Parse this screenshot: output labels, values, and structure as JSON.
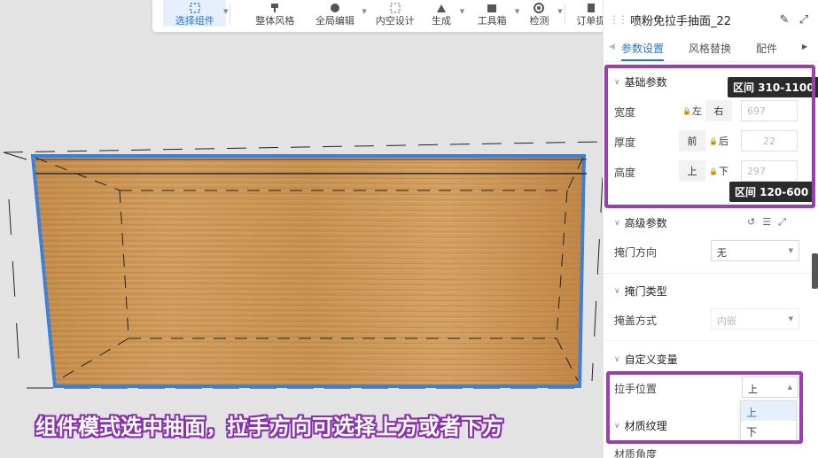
{
  "toolbar": {
    "items": [
      {
        "label": "选择组件",
        "icon": "select-component-icon"
      },
      {
        "label": "整体风格",
        "icon": "style-icon"
      },
      {
        "label": "全局编辑",
        "icon": "global-edit-icon"
      },
      {
        "label": "内空设计",
        "icon": "inner-space-icon"
      },
      {
        "label": "生成",
        "icon": "generate-icon"
      },
      {
        "label": "工具箱",
        "icon": "toolbox-icon"
      },
      {
        "label": "检测",
        "icon": "detect-icon"
      },
      {
        "label": "订单提",
        "icon": "order-icon"
      }
    ]
  },
  "panel": {
    "title": "喷粉免拉手抽面_22",
    "tabs": [
      "参数设置",
      "风格替换",
      "配件"
    ],
    "basic": {
      "title": "基础参数",
      "width_label": "宽度",
      "width_seg": [
        "左",
        "右"
      ],
      "width_value": "697",
      "thickness_label": "厚度",
      "thickness_seg": [
        "前",
        "后"
      ],
      "thickness_value": "22",
      "height_label": "高度",
      "height_seg": [
        "上",
        "下"
      ],
      "height_value": "297",
      "range_top": "区间 310-1100",
      "range_bottom": "区间 120-600"
    },
    "advanced": {
      "title": "高级参数",
      "door_dir_label": "掩门方向",
      "door_dir_value": "无"
    },
    "door_type": {
      "title": "掩门类型",
      "cover_label": "掩盖方式",
      "cover_value": "内嵌"
    },
    "custom": {
      "title": "自定义变量",
      "handle_label": "拉手位置",
      "handle_value": "上",
      "handle_options": [
        "上",
        "下"
      ]
    },
    "material": {
      "title": "材质纹理",
      "angle_label": "材质角度"
    }
  },
  "caption": "组件模式选中抽面，拉手方向可选择上方或者下方",
  "colors": {
    "accent": "#2a73d9",
    "highlight": "#9b3fb0",
    "wood": "#c8944f"
  }
}
